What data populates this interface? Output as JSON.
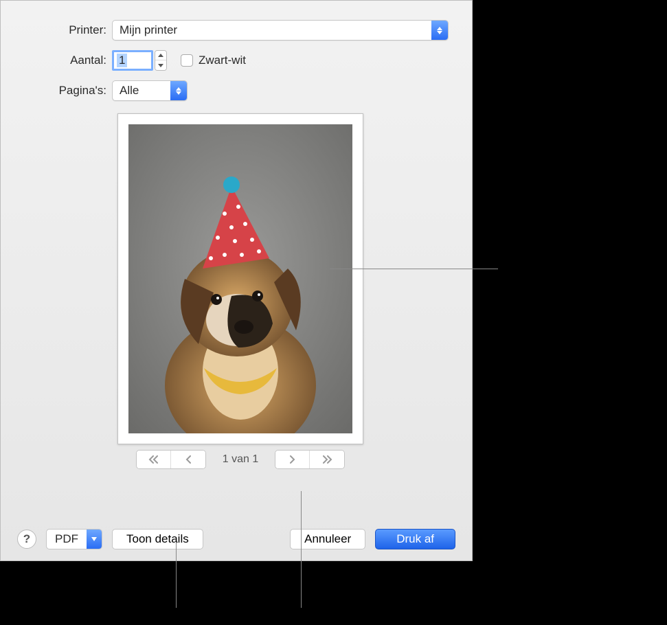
{
  "labels": {
    "printer": "Printer:",
    "aantal": "Aantal:",
    "paginas": "Pagina's:"
  },
  "printer": {
    "selected": "Mijn printer"
  },
  "copies": {
    "value": "1",
    "bw_label": "Zwart-wit"
  },
  "pages": {
    "selected": "Alle"
  },
  "pager": {
    "text": "1 van 1"
  },
  "footer": {
    "help": "?",
    "pdf": "PDF",
    "details": "Toon details",
    "cancel": "Annuleer",
    "print": "Druk af"
  }
}
